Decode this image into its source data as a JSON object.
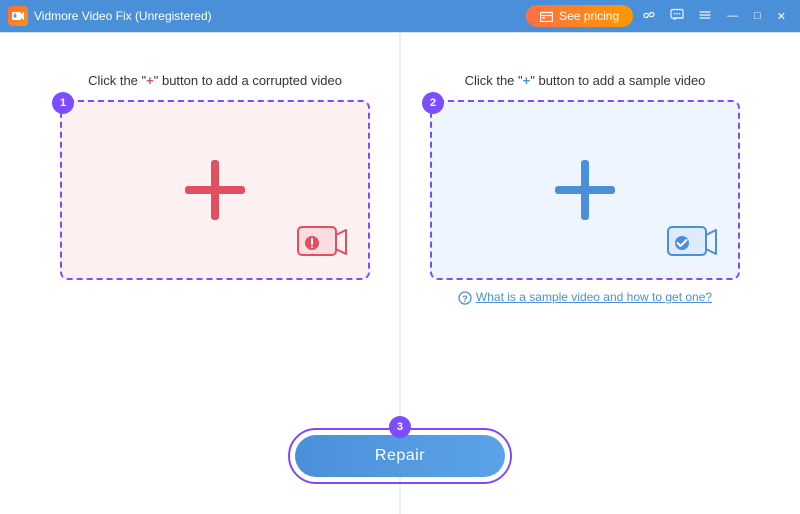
{
  "titlebar": {
    "logo_text": "V",
    "title": "Vidmore Video Fix (Unregistered)",
    "pricing_label": "See pricing",
    "icons": {
      "link": "🔗",
      "chat": "💬",
      "menu": "≡",
      "minimize": "—",
      "maximize": "□",
      "close": "✕"
    }
  },
  "panel_left": {
    "badge": "1",
    "instruction_pre": "Click the \"",
    "instruction_plus": "+",
    "instruction_post": "\" button to add a corrupted video"
  },
  "panel_right": {
    "badge": "2",
    "instruction_pre": "Click the \"",
    "instruction_plus": "+",
    "instruction_post": "\" button to add a sample video",
    "help_text": "What is a sample video and how to get one?"
  },
  "repair_section": {
    "badge": "3",
    "button_label": "Repair"
  }
}
